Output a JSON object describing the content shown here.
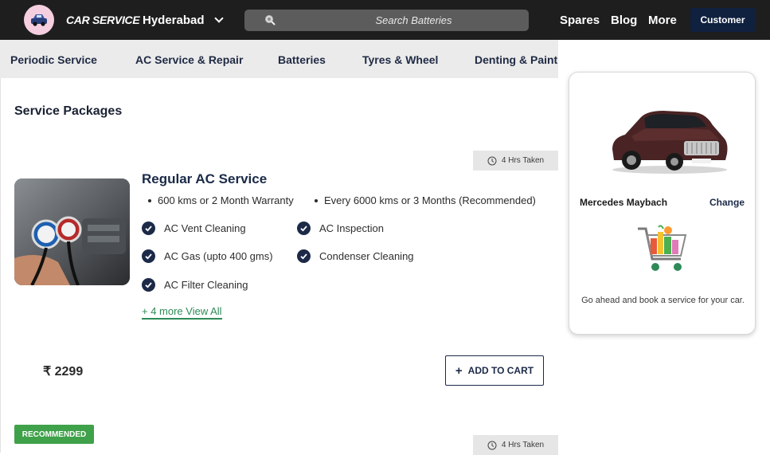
{
  "header": {
    "brand": "CAR SERVICE",
    "city": "Hyderabad",
    "search_placeholder": "Search Batteries",
    "nav": [
      "Spares",
      "Blog",
      "More"
    ],
    "customer_label": "Customer"
  },
  "categories": [
    "Periodic Service",
    "AC Service & Repair",
    "Batteries",
    "Tyres & Wheel",
    "Denting & Painting"
  ],
  "main": {
    "section_title": "Service Packages",
    "packages": [
      {
        "time_taken": "4 Hrs Taken",
        "title": "Regular AC Service",
        "bullets": [
          "600 kms or 2 Month Warranty",
          "Every 6000 kms or 3 Months (Recommended)"
        ],
        "features": [
          "AC Vent Cleaning",
          "AC Inspection",
          "AC Gas (upto 400 gms)",
          "Condenser Cleaning",
          "AC Filter Cleaning"
        ],
        "more_link": "+ 4 more View All",
        "price": "₹ 2299",
        "add_to_cart": "ADD TO CART"
      },
      {
        "badge": "RECOMMENDED",
        "time_taken": "4 Hrs Taken"
      }
    ]
  },
  "sidebar_card": {
    "car_name": "Mercedes Maybach",
    "change_label": "Change",
    "message": "Go ahead and book a service for your car."
  },
  "icons": {
    "logo": "car-logo-icon",
    "city_dropdown": "chevron-down-icon",
    "search": "search-icon",
    "clock": "clock-icon",
    "check": "check-circle-icon",
    "plus": "plus-icon",
    "cart": "shopping-cart-icon"
  },
  "colors": {
    "topbar": "#1e1e1e",
    "primary_navy": "#1c2a48",
    "customer_button": "#10203f",
    "link_green": "#2e8b57",
    "recommended_green": "#3fa14a",
    "category_bar": "#ebebeb"
  }
}
